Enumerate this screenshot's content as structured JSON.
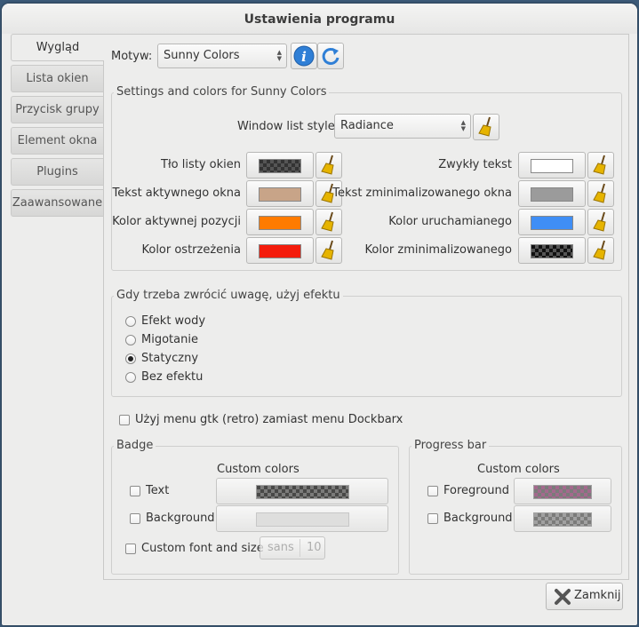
{
  "window": {
    "title": "Ustawienia programu"
  },
  "tabs": [
    {
      "label": "Wygląd",
      "active": true
    },
    {
      "label": "Lista okien"
    },
    {
      "label": "Przycisk grupy"
    },
    {
      "label": "Element okna"
    },
    {
      "label": "Plugins"
    },
    {
      "label": "Zaawansowane"
    }
  ],
  "theme": {
    "label": "Motyw:",
    "value": "Sunny Colors",
    "info_icon": "info-icon",
    "reload_icon": "refresh-icon"
  },
  "settings": {
    "title": "Settings and colors for Sunny Colors",
    "window_list_style_label": "Window list style:",
    "window_list_style_value": "Radiance",
    "colors_left": [
      {
        "label": "Tło listy okien",
        "color": "#3a3a3a",
        "pattern": "checker"
      },
      {
        "label": "Tekst aktywnego okna",
        "color": "#c8a488"
      },
      {
        "label": "Kolor aktywnej pozycji",
        "color": "#ff7b00"
      },
      {
        "label": "Kolor ostrzeżenia",
        "color": "#f41c0c"
      }
    ],
    "colors_right": [
      {
        "label": "Zwykły tekst",
        "color": "#ffffff"
      },
      {
        "label": "Tekst zminimalizowanego okna",
        "color": "#9b9b9b"
      },
      {
        "label": "Kolor uruchamianego",
        "color": "#3f8ef5"
      },
      {
        "label": "Kolor zminimalizowanego",
        "color": "#1c1c1c",
        "pattern": "checker"
      }
    ]
  },
  "effect": {
    "title": "Gdy trzeba zwrócić uwagę, użyj efektu",
    "options": [
      {
        "label": "Efekt wody",
        "checked": false
      },
      {
        "label": "Migotanie",
        "checked": false
      },
      {
        "label": "Statyczny",
        "checked": true
      },
      {
        "label": "Bez efektu",
        "checked": false
      }
    ]
  },
  "gtk_menu": {
    "label": "Użyj menu gtk (retro) zamiast menu Dockbarx",
    "checked": false
  },
  "badge": {
    "title": "Badge",
    "custom_colors": "Custom colors",
    "text_label": "Text",
    "background_label": "Background",
    "custom_font_label": "Custom font and size",
    "font_name": "sans",
    "font_size": "10"
  },
  "progress": {
    "title": "Progress bar",
    "custom_colors": "Custom colors",
    "foreground_label": "Foreground",
    "background_label": "Background"
  },
  "close_button": {
    "label": "Zamknij"
  },
  "colors": {
    "accent_blue": "#2f7fd6",
    "broom_yellow": "#e6b400"
  }
}
